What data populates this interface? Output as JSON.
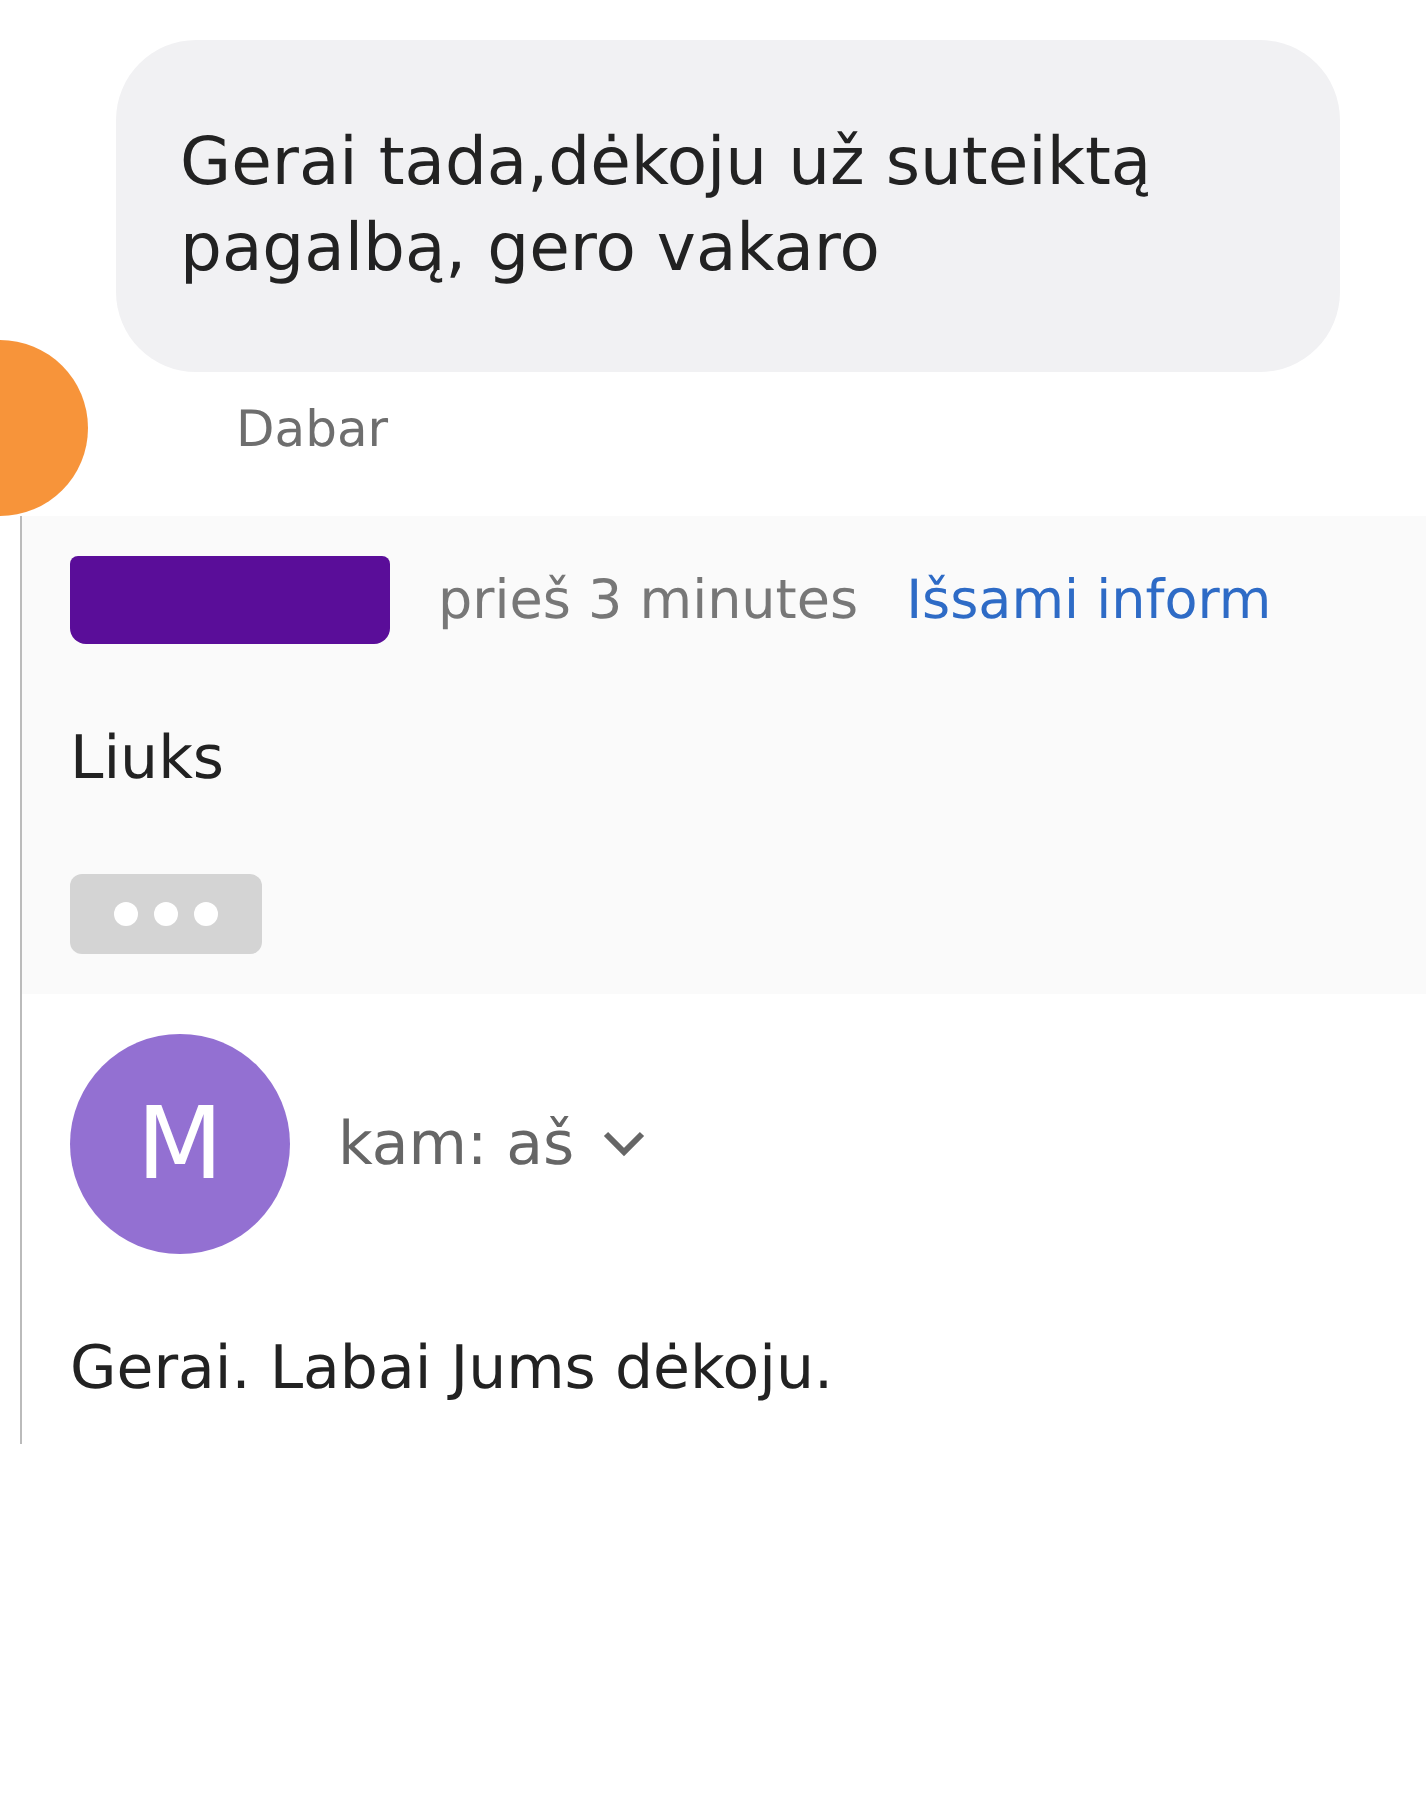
{
  "chat_message": {
    "text": "Gerai tada,dėkoju už suteiktą pagalbą, gero vakaro",
    "time": "Dabar"
  },
  "email_1": {
    "time": "prieš 3 minutes",
    "details_link": "Išsami inform",
    "body": "Liuks"
  },
  "email_2": {
    "avatar_letter": "M",
    "recipient": "kam: aš",
    "body": "Gerai. Labai Jums dėkoju."
  }
}
